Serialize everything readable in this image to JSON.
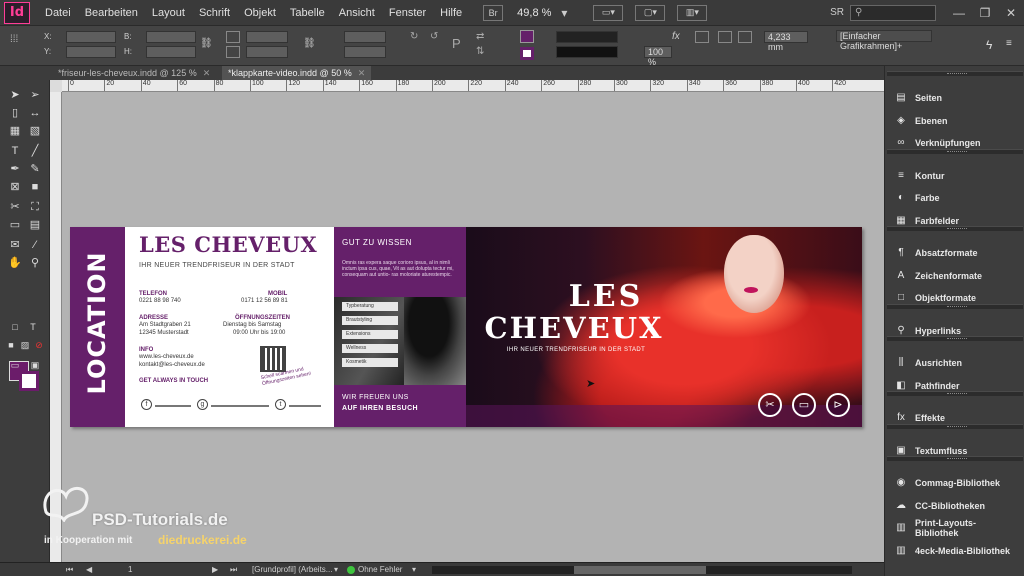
{
  "app": {
    "logo": "Id"
  },
  "menu": [
    "Datei",
    "Bearbeiten",
    "Layout",
    "Schrift",
    "Objekt",
    "Tabelle",
    "Ansicht",
    "Fenster",
    "Hilfe"
  ],
  "menubar": {
    "br_badge": "Br",
    "zoom": "49,8 %",
    "workspace": "SR"
  },
  "control": {
    "x_label": "X:",
    "y_label": "Y:",
    "b_label": "B:",
    "h_label": "H:",
    "stroke_weight": "4,233 mm",
    "opacity": "100 %",
    "object_style": "[Einfacher Grafikrahmen]+"
  },
  "tabs": [
    {
      "label": "*friseur-les-cheveux.indd @ 125 %",
      "active": false
    },
    {
      "label": "*klappkarte-video.indd @ 50 %",
      "active": true
    }
  ],
  "ruler_ticks": [
    "0",
    "20",
    "40",
    "60",
    "80",
    "100",
    "120",
    "140",
    "160",
    "180",
    "200",
    "220",
    "240",
    "260",
    "280",
    "300",
    "320",
    "340",
    "360",
    "380",
    "400",
    "420"
  ],
  "document": {
    "location": "LOCATION",
    "title": "LES CHEVEUX",
    "subtitle": "IHR NEUER TRENDFRISEUR IN DER STADT",
    "telefon_label": "TELEFON",
    "telefon": "0221 88 98 740",
    "mobil_label": "MOBIL",
    "mobil": "0171 12 56 89 81",
    "adresse_label": "ADRESSE",
    "adresse_line1": "Am Stadtgraben 21",
    "adresse_line2": "12345 Musterstadt",
    "oeffnung_label": "ÖFFNUNGSZEITEN",
    "oeffnung_line1": "Dienstag bis Samstag",
    "oeffnung_line2": "09:00 Uhr bis 19:00",
    "info_label": "INFO",
    "info_line1": "www.les-cheveux.de",
    "info_line2": "kontakt@les-cheveux.de",
    "get_touch": "GET ALWAYS IN TOUCH",
    "qr_note": "Schell scannen und Öffnungszeiten sehen!",
    "gut_heading": "GUT ZU WISSEN",
    "gut_text": "Omnis ras expera saque corioro ipsus, al in nimli inctum ipsa cus, quae, Vit as aut dolupta tectur mi, consequam aut untio- ras moloriate aturestempic.",
    "services": [
      "Typberatung",
      "Brautstyling",
      "Extensions",
      "Wellness",
      "Kosmetik"
    ],
    "gut_foot1": "WIR FREUEN UNS",
    "gut_foot2": "AUF IHREN BESUCH",
    "hero_title1": "LES",
    "hero_title2": "CHEVEUX",
    "hero_sub": "IHR NEUER TRENDFRISEUR IN DER STADT"
  },
  "watermark": {
    "brand": "PSD-Tutorials.de",
    "coop": "in Kooperation mit",
    "partner": "diedruckerei.de"
  },
  "status": {
    "page": "1",
    "profile": "[Grundprofil] (Arbeits...",
    "preflight": "Ohne Fehler"
  },
  "panels": [
    {
      "icon": "pages-icon",
      "glyph": "▤",
      "label": "Seiten"
    },
    {
      "icon": "layers-icon",
      "glyph": "◈",
      "label": "Ebenen"
    },
    {
      "icon": "links-icon",
      "glyph": "∞",
      "label": "Verknüpfungen"
    },
    {
      "icon": "stroke-icon",
      "glyph": "≡",
      "label": "Kontur"
    },
    {
      "icon": "color-icon",
      "glyph": "◐",
      "label": "Farbe"
    },
    {
      "icon": "swatches-icon",
      "glyph": "▦",
      "label": "Farbfelder"
    },
    {
      "icon": "paragraph-styles-icon",
      "glyph": "¶",
      "label": "Absatzformate"
    },
    {
      "icon": "character-styles-icon",
      "glyph": "A",
      "label": "Zeichenformate"
    },
    {
      "icon": "object-styles-icon",
      "glyph": "□",
      "label": "Objektformate"
    },
    {
      "icon": "hyperlinks-icon",
      "glyph": "⚲",
      "label": "Hyperlinks"
    },
    {
      "icon": "align-icon",
      "glyph": "⫼",
      "label": "Ausrichten"
    },
    {
      "icon": "pathfinder-icon",
      "glyph": "◧",
      "label": "Pathfinder"
    },
    {
      "icon": "effects-icon",
      "glyph": "fx",
      "label": "Effekte"
    },
    {
      "icon": "text-wrap-icon",
      "glyph": "▣",
      "label": "Textumfluss"
    },
    {
      "icon": "commag-library-icon",
      "glyph": "◉",
      "label": "Commag-Bibliothek"
    },
    {
      "icon": "cc-libraries-icon",
      "glyph": "☁",
      "label": "CC-Bibliotheken"
    },
    {
      "icon": "print-layouts-library-icon",
      "glyph": "▥",
      "label": "Print-Layouts-Bibliothek"
    },
    {
      "icon": "media-library-icon",
      "glyph": "▥",
      "label": "4eck-Media-Bibliothek"
    }
  ],
  "colors": {
    "brand_purple": "#65206a",
    "preflight_ok": "#3ec43e",
    "logo_pink": "#ff3d97"
  }
}
